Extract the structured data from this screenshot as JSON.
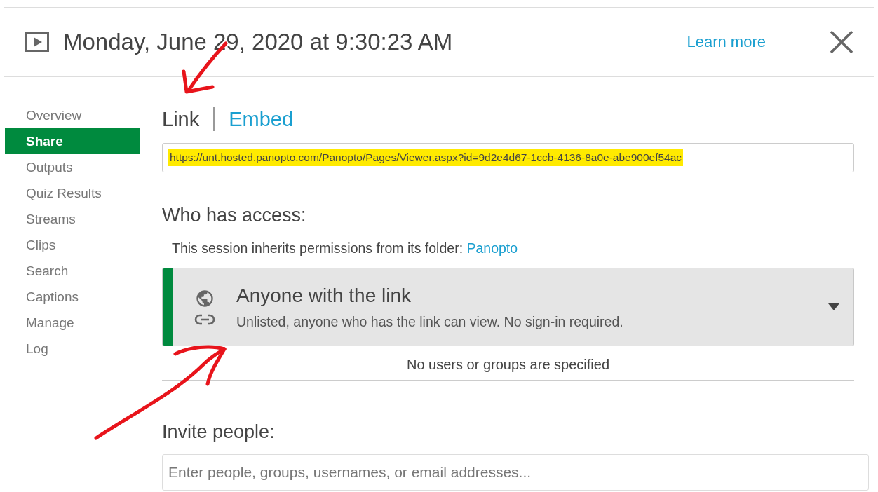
{
  "header": {
    "title": "Monday, June 29, 2020 at 9:30:23 AM",
    "learn_more": "Learn more"
  },
  "sidebar": {
    "items": [
      {
        "label": "Overview",
        "selected": false
      },
      {
        "label": "Share",
        "selected": true
      },
      {
        "label": "Outputs",
        "selected": false
      },
      {
        "label": "Quiz Results",
        "selected": false
      },
      {
        "label": "Streams",
        "selected": false
      },
      {
        "label": "Clips",
        "selected": false
      },
      {
        "label": "Search",
        "selected": false
      },
      {
        "label": "Captions",
        "selected": false
      },
      {
        "label": "Manage",
        "selected": false
      },
      {
        "label": "Log",
        "selected": false
      }
    ]
  },
  "tabs": [
    {
      "label": "Link",
      "selected": true
    },
    {
      "label": "Embed",
      "selected": false
    }
  ],
  "link_field": {
    "value": "https://unt.hosted.panopto.com/Panopto/Pages/Viewer.aspx?id=9d2e4d67-1ccb-4136-8a0e-abe900ef54ac",
    "highlighted": true
  },
  "access": {
    "heading": "Who has access:",
    "inherit_text": "This session inherits permissions from its folder:",
    "folder_link": "Panopto",
    "option_title": "Anyone with the link",
    "option_description": "Unlisted, anyone who has the link can view. No sign-in required.",
    "users_note": "No users or groups are specified"
  },
  "invite": {
    "heading": "Invite people:",
    "placeholder": "Enter people, groups, usernames, or email addresses..."
  },
  "annotations": [
    {
      "kind": "arrow"
    },
    {
      "kind": "arrow"
    }
  ]
}
